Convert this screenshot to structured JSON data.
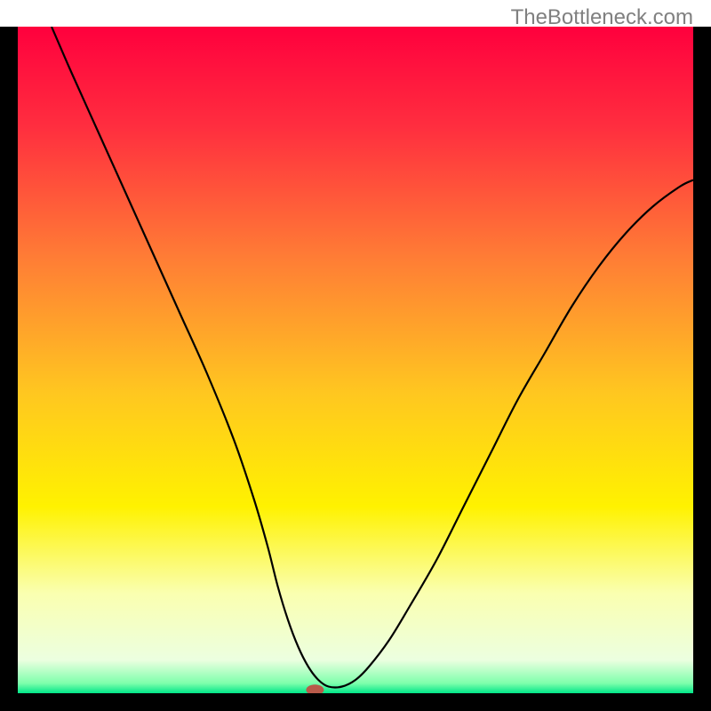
{
  "watermark": "TheBottleneck.com",
  "chart_data": {
    "type": "line",
    "title": "",
    "xlabel": "",
    "ylabel": "",
    "xlim": [
      0,
      100
    ],
    "ylim": [
      0,
      100
    ],
    "grid": false,
    "legend": false,
    "background_gradient": {
      "type": "vertical",
      "stops": [
        {
          "offset": 0.0,
          "color": "#ff003d"
        },
        {
          "offset": 0.15,
          "color": "#ff2e3f"
        },
        {
          "offset": 0.35,
          "color": "#ff7e35"
        },
        {
          "offset": 0.55,
          "color": "#ffc720"
        },
        {
          "offset": 0.72,
          "color": "#fff200"
        },
        {
          "offset": 0.85,
          "color": "#faffb0"
        },
        {
          "offset": 0.95,
          "color": "#ecffe0"
        },
        {
          "offset": 0.985,
          "color": "#7effac"
        },
        {
          "offset": 1.0,
          "color": "#00e688"
        }
      ]
    },
    "series": [
      {
        "name": "bottleneck-curve",
        "color": "#000000",
        "width": 2.2,
        "x": [
          5,
          8,
          12,
          16,
          20,
          24,
          28,
          32,
          35,
          37,
          38.5,
          40,
          41.5,
          43,
          44.5,
          46,
          48,
          50,
          52,
          55,
          58,
          62,
          66,
          70,
          74,
          78,
          82,
          86,
          90,
          94,
          98,
          100
        ],
        "y": [
          100,
          93,
          84,
          75,
          66,
          57,
          48,
          38,
          29,
          22,
          16,
          11,
          7,
          4,
          2,
          1,
          1,
          2,
          4,
          8,
          13,
          20,
          28,
          36,
          44,
          51,
          58,
          64,
          69,
          73,
          76,
          77
        ]
      }
    ],
    "marker": {
      "name": "optimal-point",
      "x": 44,
      "y": 0.5,
      "color": "#b85a4a",
      "rx": 10,
      "ry": 6
    }
  }
}
